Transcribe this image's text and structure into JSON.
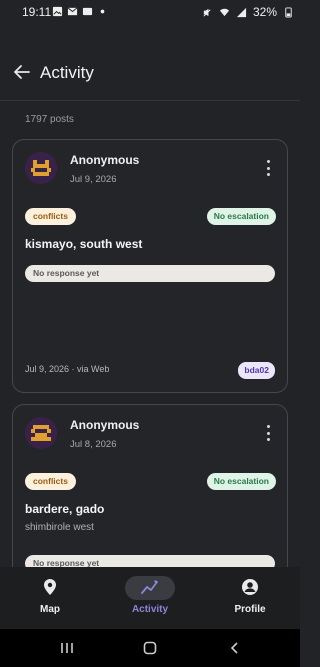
{
  "status_bar": {
    "time": "19:11",
    "battery": "32%",
    "left_icons": [
      "photo-icon",
      "gmail-icon",
      "mail-icon",
      "dot-icon"
    ],
    "right_icons": [
      "mute-icon",
      "wifi-icon",
      "signal-icon",
      "battery-icon"
    ]
  },
  "app_bar": {
    "title": "Activity",
    "back_icon": "arrow-back-icon"
  },
  "feed": {
    "posts_count": "1797 posts",
    "posts": [
      {
        "author": "Anonymous",
        "date": "Jul 9, 2026",
        "tag": "conflicts",
        "escalation": "No escalation",
        "location": "kismayo, south west",
        "sublocation": "",
        "response": "No response yet",
        "footer": "Jul 9, 2026 · via Web",
        "code": "bda02"
      },
      {
        "author": "Anonymous",
        "date": "Jul 8, 2026",
        "tag": "conflicts",
        "escalation": "No escalation",
        "location": "bardere, gado",
        "sublocation": "shimbirole west",
        "response": "No response yet"
      }
    ]
  },
  "bottom_nav": {
    "items": [
      {
        "label": "Map",
        "icon": "map-pin-icon",
        "active": false
      },
      {
        "label": "Activity",
        "icon": "activity-chart-icon",
        "active": true
      },
      {
        "label": "Profile",
        "icon": "profile-icon",
        "active": false
      }
    ]
  },
  "colors": {
    "background": "#222326",
    "accent": "#8c84d8",
    "tag_bg": "#fdf0dc",
    "escalation_bg": "#dff3e6"
  }
}
